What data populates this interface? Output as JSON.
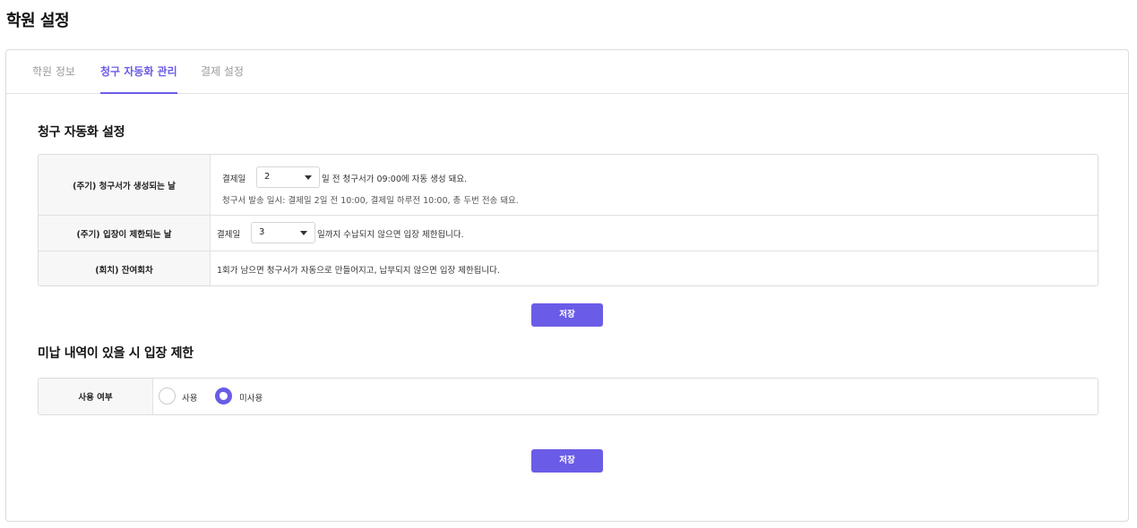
{
  "page": {
    "title": "학원 설정"
  },
  "tabs": [
    {
      "label": "학원 정보"
    },
    {
      "label": "청구 자동화 관리"
    },
    {
      "label": "결제 설정"
    }
  ],
  "active_tab": "청구 자동화 관리",
  "billing_automation": {
    "title": "청구 자동화 설정",
    "rows": [
      {
        "header": "(주기) 청구서가 생성되는 날",
        "prefix": "결제일",
        "select_value": "2",
        "suffix": "일 전 청구서가 09:00에 자동 생성 돼요.",
        "note": "청구서 발송 일시: 결제일 2일 전 10:00, 결제일 하루전 10:00, 총 두번 전송 돼요."
      },
      {
        "header": "(주기) 입장이 제한되는 날",
        "prefix": "결제일",
        "select_value": "3",
        "suffix": "일까지 수납되지 않으면 입장 제한됩니다."
      },
      {
        "header": "(회치) 잔여회차",
        "text": "1회가 남으면 청구서가 자동으로 만들어지고, 납부되지 않으면 입장 제한됩니다."
      }
    ],
    "save_label": "저장"
  },
  "unpaid_restriction": {
    "title": "미납 내역이 있을 시 입장 제한",
    "header": "사용 여부",
    "options": [
      {
        "label": "사용",
        "checked": false
      },
      {
        "label": "미사용",
        "checked": true
      }
    ],
    "save_label": "저장"
  },
  "colors": {
    "accent": "#6b5ce7",
    "border": "#dcdcdc",
    "header_bg": "#f7f7f7"
  }
}
